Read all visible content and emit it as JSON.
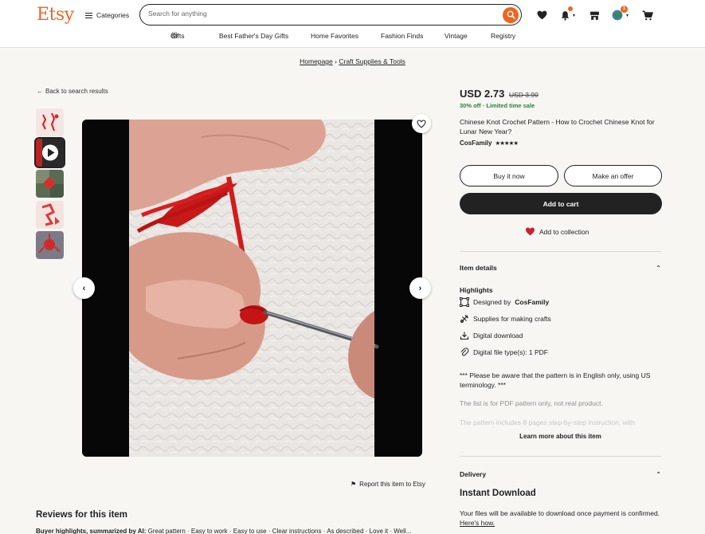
{
  "header": {
    "logo": "Etsy",
    "categories_label": "Categories",
    "search_placeholder": "Search for anything",
    "cart_badge": "1",
    "colors": {
      "brand": "#f1641e",
      "sale_green": "#258635",
      "dark": "#222222"
    }
  },
  "nav": {
    "links": [
      "Gifts",
      "Best Father's Day Gifts",
      "Home Favorites",
      "Fashion Finds",
      "Vintage",
      "Registry"
    ]
  },
  "breadcrumb": {
    "items": [
      "Homepage",
      "Craft Supplies & Tools"
    ],
    "separator": "›"
  },
  "back_link": "Back to search results",
  "gallery": {
    "thumbnail_count": 5,
    "selected_index": 1,
    "media_type": "video"
  },
  "listing": {
    "price": "USD 2.73",
    "original_price": "USD 3.90",
    "discount": "30% off",
    "sale_note": "Limited time sale",
    "title": "Chinese Knot Crochet Pattern - How to Crochet Chinese Knot for Lunar New Year?",
    "shop_name": "CosFamily",
    "stars": "★★★★★",
    "rating": 4.5
  },
  "buttons": {
    "buy_now": "Buy it now",
    "make_offer": "Make an offer",
    "add_to_cart": "Add to cart",
    "add_to_collection": "Add to collection"
  },
  "item_details": {
    "heading": "Item details",
    "highlights_label": "Highlights",
    "highlights": [
      {
        "icon": "designer-icon",
        "prefix": "Designed by",
        "value": "CosFamily"
      },
      {
        "icon": "craft-supplies-icon",
        "prefix": "Supplies for making crafts",
        "value": ""
      },
      {
        "icon": "download-icon",
        "prefix": "Digital download",
        "value": ""
      },
      {
        "icon": "paperclip-icon",
        "prefix": "Digital file type(s): 1 PDF",
        "value": ""
      }
    ],
    "description": [
      "*** Please be aware that the pattern is in English only, using US terminology. ***",
      "The list is for PDF pattern only, not real product.",
      "The pattern includes 8 pages step-by-step instruction, with"
    ],
    "learn_more": "Learn more about this item"
  },
  "delivery": {
    "heading": "Delivery",
    "title": "Instant Download",
    "text": "Your files will be available to download once payment is confirmed.",
    "link": "Here's how."
  },
  "report_link": "Report this item to Etsy",
  "reviews": {
    "heading": "Reviews for this item",
    "highlights_label": "Buyer highlights, summarized by AI:",
    "highlights": [
      "Great pattern",
      "Easy to work",
      "Easy to use",
      "Clear instructions",
      "As described",
      "Love it",
      "Well..."
    ]
  }
}
